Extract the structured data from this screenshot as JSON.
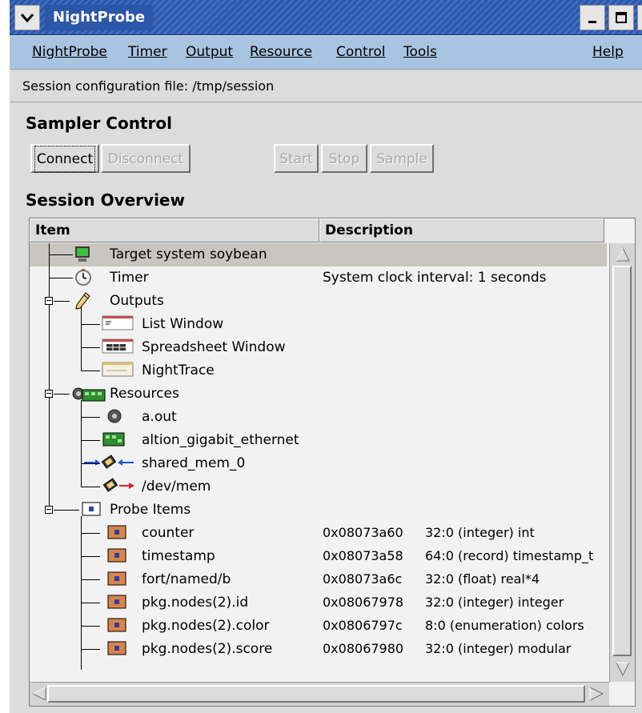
{
  "window": {
    "title": "NightProbe"
  },
  "menubar": {
    "items": [
      {
        "label": "NightProbe"
      },
      {
        "label": "Timer"
      },
      {
        "label": "Output"
      },
      {
        "label": "Resource"
      },
      {
        "label": "Control"
      },
      {
        "label": "Tools"
      },
      {
        "label": "Help"
      }
    ]
  },
  "info": {
    "session_config": "Session configuration file: /tmp/session"
  },
  "sampler": {
    "title": "Sampler Control",
    "connect": "Connect",
    "disconnect": "Disconnect",
    "start": "Start",
    "stop": "Stop",
    "sample": "Sample"
  },
  "overview": {
    "title": "Session Overview",
    "col_item": "Item",
    "col_description": "Description",
    "rows": [
      {
        "label": "Target system soybean",
        "icon": "monitor-icon",
        "desc": ""
      },
      {
        "label": "Timer",
        "icon": "clock-icon",
        "desc": "System clock interval: 1 seconds"
      },
      {
        "label": "Outputs",
        "icon": "pencil-icon",
        "desc": ""
      },
      {
        "label": "List Window",
        "icon": "list-window-icon",
        "desc": ""
      },
      {
        "label": "Spreadsheet Window",
        "icon": "spreadsheet-window-icon",
        "desc": ""
      },
      {
        "label": "NightTrace",
        "icon": "nighttrace-icon",
        "desc": ""
      },
      {
        "label": "Resources",
        "icon": "resources-icon",
        "desc": ""
      },
      {
        "label": "a.out",
        "icon": "gear-icon",
        "desc": ""
      },
      {
        "label": "altion_gigabit_ethernet",
        "icon": "circuit-board-icon",
        "desc": ""
      },
      {
        "label": "shared_mem_0",
        "icon": "shared-memory-icon",
        "desc": ""
      },
      {
        "label": "/dev/mem",
        "icon": "memory-chip-icon",
        "desc": ""
      },
      {
        "label": "Probe Items",
        "icon": "probe-items-icon",
        "desc": ""
      },
      {
        "label": "counter",
        "icon": "probe-item-icon",
        "addr": "0x08073a60",
        "type": "32:0 (integer) int"
      },
      {
        "label": "timestamp",
        "icon": "probe-item-icon",
        "addr": "0x08073a58",
        "type": "64:0 (record) timestamp_t"
      },
      {
        "label": "fort/named/b",
        "icon": "probe-item-icon",
        "addr": "0x08073a6c",
        "type": "32:0 (float) real*4"
      },
      {
        "label": "pkg.nodes(2).id",
        "icon": "probe-item-icon",
        "addr": "0x08067978",
        "type": "32:0 (integer) integer"
      },
      {
        "label": "pkg.nodes(2).color",
        "icon": "probe-item-icon",
        "addr": "0x0806797c",
        "type": " 8:0 (enumeration) colors"
      },
      {
        "label": "pkg.nodes(2).score",
        "icon": "probe-item-icon",
        "addr": "0x08067980",
        "type": "32:0 (integer) modular"
      }
    ]
  },
  "colors": {
    "titlebar": "#2c56a8",
    "menubar": "#a9c4e0",
    "window_bg": "#dcdcdc",
    "selected_row": "#c9c5c1",
    "probe_orange": "#d9834a"
  }
}
